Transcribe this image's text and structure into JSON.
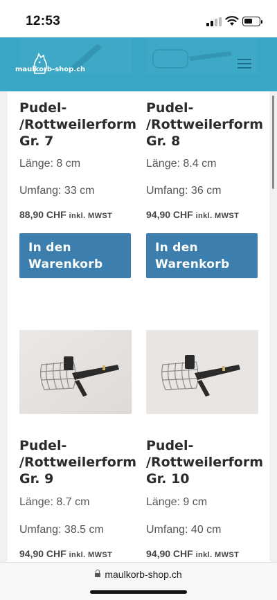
{
  "status": {
    "time": "12:53"
  },
  "site": {
    "logo_text": "maulkorb-shop.ch"
  },
  "products": [
    {
      "title": "Pudel-\n/Rottweilerform\nGr. 7",
      "laenge": "Länge: 8 cm",
      "umfang": "Umfang: 33 cm",
      "price": "88,90 CHF",
      "tax": "inkl. MWST",
      "button": "In den Warenkorb"
    },
    {
      "title": "Pudel-\n/Rottweilerform\nGr. 8",
      "laenge": "Länge: 8.4 cm",
      "umfang": "Umfang: 36 cm",
      "price": "94,90 CHF",
      "tax": "inkl. MWST",
      "button": "In den Warenkorb"
    },
    {
      "title": "Pudel-\n/Rottweilerform\nGr. 9",
      "laenge": "Länge: 8.7 cm",
      "umfang": "Umfang: 38.5 cm",
      "price": "94,90 CHF",
      "tax": "inkl. MWST"
    },
    {
      "title": "Pudel-\n/Rottweilerform\nGr. 10",
      "laenge": "Länge: 9 cm",
      "umfang": "Umfang: 40 cm",
      "price": "94,90 CHF",
      "tax": "inkl. MWST"
    }
  ],
  "browser": {
    "url": "maulkorb-shop.ch"
  },
  "colors": {
    "header": "#39a6c3",
    "button": "#3c7fae"
  }
}
